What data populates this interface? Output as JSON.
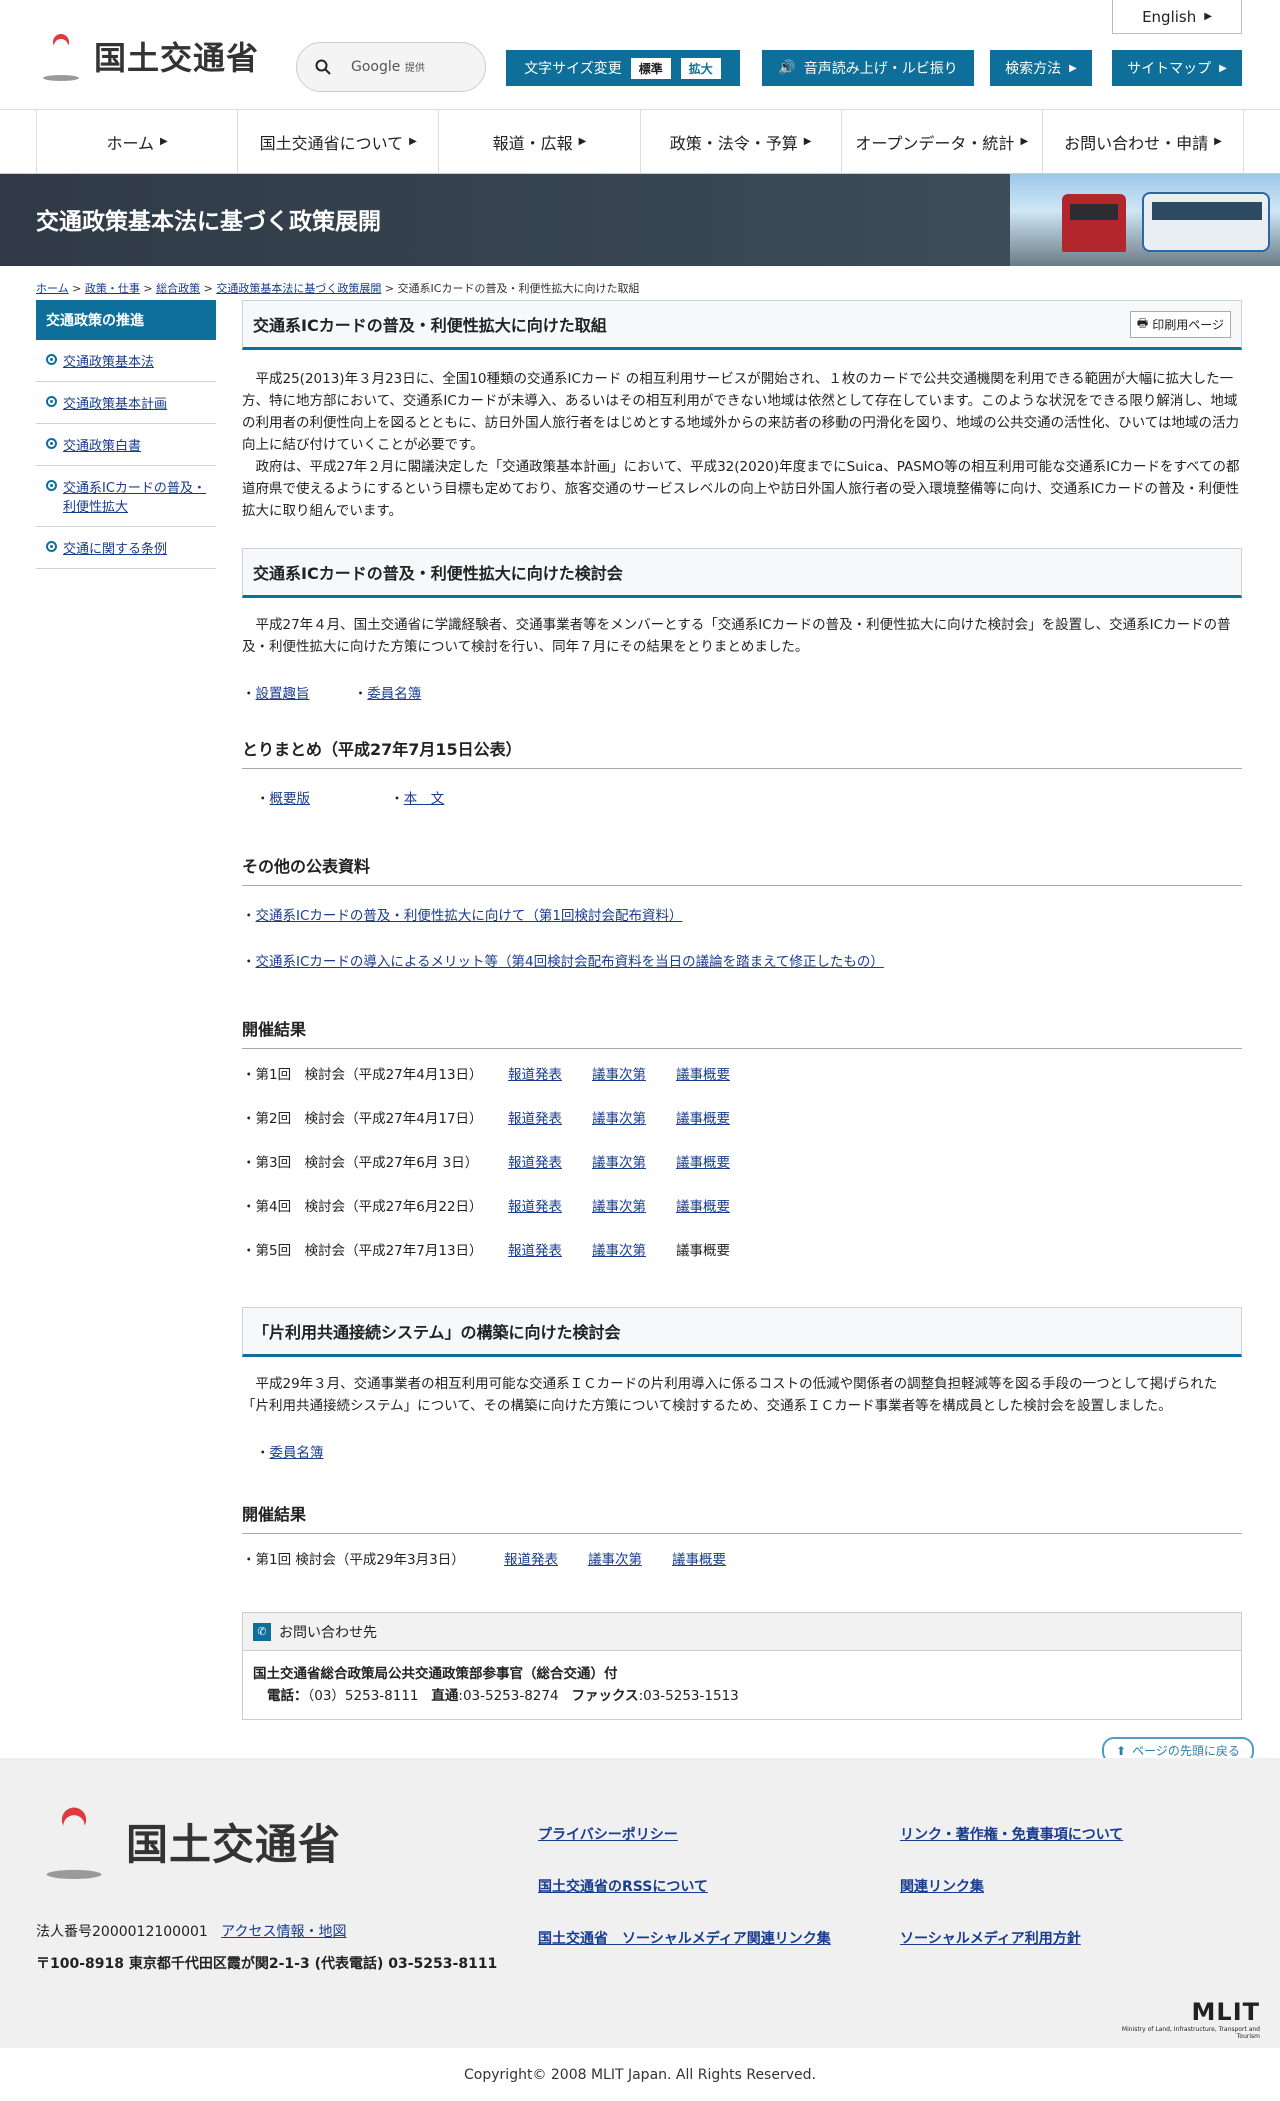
{
  "header": {
    "logo_text": "国土交通省",
    "search_placeholder": "Google",
    "search_provider": "提供",
    "english_label": "English",
    "font_size_label": "文字サイズ変更",
    "font_size_normal": "標準",
    "font_size_large": "拡大",
    "read_aloud_label": "音声読み上げ・ルビ振り",
    "search_method_label": "検索方法",
    "sitemap_label": "サイトマップ"
  },
  "nav": [
    {
      "label": "ホーム"
    },
    {
      "label": "国土交通省について"
    },
    {
      "label": "報道・広報"
    },
    {
      "label": "政策・法令・予算"
    },
    {
      "label": "オープンデータ・統計"
    },
    {
      "label": "お問い合わせ・申請"
    }
  ],
  "banner": {
    "title": "交通政策基本法に基づく政策展開"
  },
  "breadcrumb": [
    "ホーム",
    "政策・仕事",
    "総合政策",
    "交通政策基本法に基づく政策展開",
    "交通系ICカードの普及・利便性拡大に向けた取組"
  ],
  "sidebar": {
    "heading": "交通政策の推進",
    "items": [
      "交通政策基本法",
      "交通政策基本計画",
      "交通政策白書",
      "交通系ICカードの普及・利便性拡大",
      "交通に関する条例"
    ]
  },
  "main": {
    "title": "交通系ICカードの普及・利便性拡大に向けた取組",
    "print_label": "印刷用ページ",
    "intro_1": "平成25(2013)年３月23日に、全国10種類の交通系ICカード の相互利用サービスが開始され、１枚のカードで公共交通機関を利用できる範囲が大幅に拡大した一方、特に地方部において、交通系ICカードが未導入、あるいはその相互利用ができない地域は依然として存在しています。このような状況をできる限り解消し、地域の利用者の利便性向上を図るとともに、訪日外国人旅行者をはじめとする地域外からの来訪者の移動の円滑化を図り、地域の公共交通の活性化、ひいては地域の活力向上に結び付けていくことが必要です。",
    "intro_2": "政府は、平成27年２月に閣議決定した「交通政策基本計画」において、平成32(2020)年度までにSuica、PASMO等の相互利用可能な交通系ICカードをすべての都道府県で使えるようにするという目標も定めており、旅客交通のサービスレベルの向上や訪日外国人旅行者の受入環境整備等に向け、交通系ICカードの普及・利便性拡大に取り組んでいます。",
    "section1": {
      "title": "交通系ICカードの普及・利便性拡大に向けた検討会",
      "text": "平成27年４月、国土交通省に学識経験者、交通事業者等をメンバーとする「交通系ICカードの普及・利便性拡大に向けた検討会」を設置し、交通系ICカードの普及・利便性拡大に向けた方策について検討を行い、同年７月にその結果をとりまとめました。",
      "link_purpose": "設置趣旨",
      "link_members": "委員名簿",
      "summary_title": "とりまとめ（平成27年7月15日公表）",
      "summary_link_outline": "概要版",
      "summary_link_body": "本　文",
      "other_title": "その他の公表資料",
      "other_link_1": "交通系ICカードの普及・利便性拡大に向けて（第1回検討会配布資料）",
      "other_link_2": "交通系ICカードの導入によるメリット等（第4回検討会配布資料を当日の議論を踏まえて修正したもの）",
      "results_title": "開催結果",
      "results": [
        {
          "label": "・第1回　検討会（平成27年4月13日）",
          "press": "報道発表",
          "agenda": "議事次第",
          "summary": "議事概要"
        },
        {
          "label": "・第2回　検討会（平成27年4月17日）",
          "press": "報道発表",
          "agenda": "議事次第",
          "summary": "議事概要"
        },
        {
          "label": "・第3回　検討会（平成27年6月 3日）",
          "press": "報道発表",
          "agenda": "議事次第",
          "summary": "議事概要"
        },
        {
          "label": "・第4回　検討会（平成27年6月22日）",
          "press": "報道発表",
          "agenda": "議事次第",
          "summary": "議事概要"
        },
        {
          "label": "・第5回　検討会（平成27年7月13日）",
          "press": "報道発表",
          "agenda": "議事次第",
          "summary": "議事概要"
        }
      ]
    },
    "section2": {
      "title": "「片利用共通接続システム」の構築に向けた検討会",
      "text": "平成29年３月、交通事業者の相互利用可能な交通系ＩＣカードの片利用導入に係るコストの低減や関係者の調整負担軽減等を図る手段の一つとして掲げられた「片利用共通接続システム」について、その構築に向けた方策について検討するため、交通系ＩＣカード事業者等を構成員とした検討会を設置しました。",
      "link_members": "委員名簿",
      "results_title": "開催結果",
      "result": {
        "label": "・第1回 検討会（平成29年3月3日）",
        "press": "報道発表",
        "agenda": "議事次第",
        "summary": "議事概要"
      }
    },
    "contact": {
      "heading": "お問い合わせ先",
      "org": "国土交通省総合政策局公共交通政策部参事官（総合交通）付",
      "tel_label": "電話：",
      "tel": "（03）5253-8111",
      "direct_label": "直通",
      "direct": ":03-5253-8274",
      "fax_label": "ファックス",
      "fax": ":03-5253-1513"
    }
  },
  "footer": {
    "pagetop_label": "ページの先頭に戻る",
    "logo_text": "国土交通省",
    "corp_no": "法人番号2000012100001",
    "access_link": "アクセス情報・地図",
    "address": "〒100-8918 東京都千代田区霞が関2-1-3 (代表電話) 03-5253-8111",
    "links": [
      "プライバシーポリシー",
      "国土交通省のRSSについて",
      "国土交通省　ソーシャルメディア関連リンク集",
      "リンク・著作権・免責事項について",
      "関連リンク集",
      "ソーシャルメディア利用方針"
    ],
    "mlit_logo": "MLIT",
    "mlit_sub": "Ministry of Land, Infrastructure, Transport and Tourism",
    "copyright": "Copyright© 2008 MLIT Japan. All Rights Reserved."
  },
  "colors": {
    "accent": "#0e6f9a",
    "banner": "#3b4a56",
    "link": "#1a3c8f"
  }
}
